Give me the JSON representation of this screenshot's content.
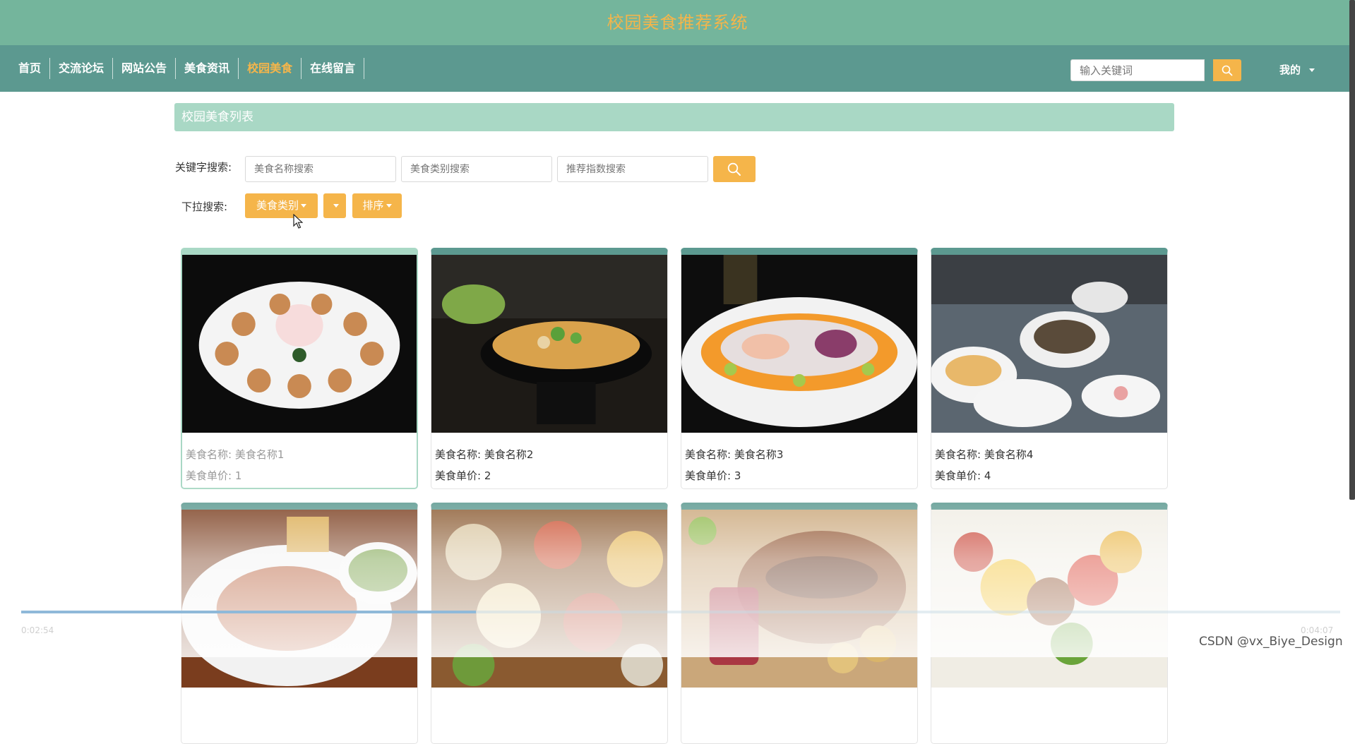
{
  "header": {
    "title": "校园美食推荐系统"
  },
  "nav": {
    "items": [
      {
        "label": "首页"
      },
      {
        "label": "交流论坛"
      },
      {
        "label": "网站公告"
      },
      {
        "label": "美食资讯"
      },
      {
        "label": "校园美食",
        "active": true
      },
      {
        "label": "在线留言"
      }
    ],
    "search_placeholder": "输入关键词",
    "search_icon": "search-icon",
    "user_label": "我的"
  },
  "section": {
    "title": "校园美食列表"
  },
  "filters": {
    "keyword_label": "关键字搜索:",
    "name_placeholder": "美食名称搜索",
    "type_placeholder": "美食类别搜索",
    "score_placeholder": "推荐指数搜索",
    "dropdown_label": "下拉搜索:",
    "dropdowns": [
      {
        "label": "美食类别"
      },
      {
        "label": ""
      },
      {
        "label": "排序"
      }
    ]
  },
  "foods": [
    {
      "name_label": "美食名称:",
      "name": "美食名称1",
      "price_label": "美食单价:",
      "price": "1"
    },
    {
      "name_label": "美食名称:",
      "name": "美食名称2",
      "price_label": "美食单价:",
      "price": "2"
    },
    {
      "name_label": "美食名称:",
      "name": "美食名称3",
      "price_label": "美食单价:",
      "price": "3"
    },
    {
      "name_label": "美食名称:",
      "name": "美食名称4",
      "price_label": "美食单价:",
      "price": "4"
    },
    {
      "name_label": "",
      "name": "",
      "price_label": "",
      "price": ""
    },
    {
      "name_label": "",
      "name": "",
      "price_label": "",
      "price": ""
    },
    {
      "name_label": "",
      "name": "",
      "price_label": "",
      "price": ""
    },
    {
      "name_label": "",
      "name": "",
      "price_label": "",
      "price": ""
    }
  ],
  "video": {
    "current_time": "0:02:54",
    "total_time": "0:04:07",
    "progress": 0.345
  },
  "watermark": "CSDN @vx_Biye_Design",
  "colors": {
    "header_bg": "#74b59c",
    "nav_bg": "#5c9990",
    "accent": "#f5b54a",
    "section_bg": "#a9d8c5"
  }
}
